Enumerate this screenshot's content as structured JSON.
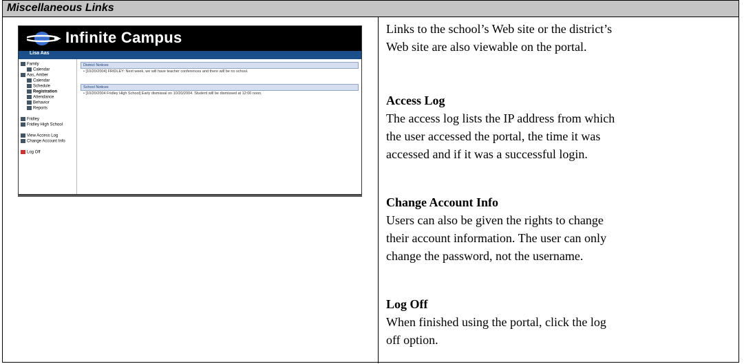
{
  "section_title": "Miscellaneous Links",
  "thumbnail": {
    "brand": "Infinite Campus",
    "user": "Lisa Aas",
    "sidebar": [
      "Family",
      "Calendar",
      "Aas, Amber",
      "Calendar",
      "Schedule",
      "Registration",
      "Attendance",
      "Behavior",
      "Reports",
      "Fridley",
      "Fridley High School",
      "View Access Log",
      "Change Account Info",
      "Log Off"
    ],
    "district_notices_header": "District Notices",
    "district_notice": "• [10/20/2004] FRIDLEY: Next week, we will have teacher conferences and there will be no school.",
    "school_notices_header": "School Notices",
    "school_notice": "• [10/20/2004 Fridley High School] Early dismissal on 10/20/2004. Student will be dismissed at 12:00 noon."
  },
  "intro": {
    "line1": "Links to the school’s Web site or the district’s",
    "line2": "Web site are also viewable on the portal."
  },
  "access_log": {
    "heading": "Access Log",
    "line1": "The access log lists the IP address from which",
    "line2": "the user accessed the portal, the time it was",
    "line3": "accessed and if it was a successful login."
  },
  "change_account": {
    "heading": "Change Account Info",
    "line1": "Users can also be given the rights to change",
    "line2": "their account information. The user can only",
    "line3": "change the password, not the username."
  },
  "log_off": {
    "heading": "Log Off",
    "line1": "When finished using the portal, click the log",
    "line2": "off option."
  }
}
